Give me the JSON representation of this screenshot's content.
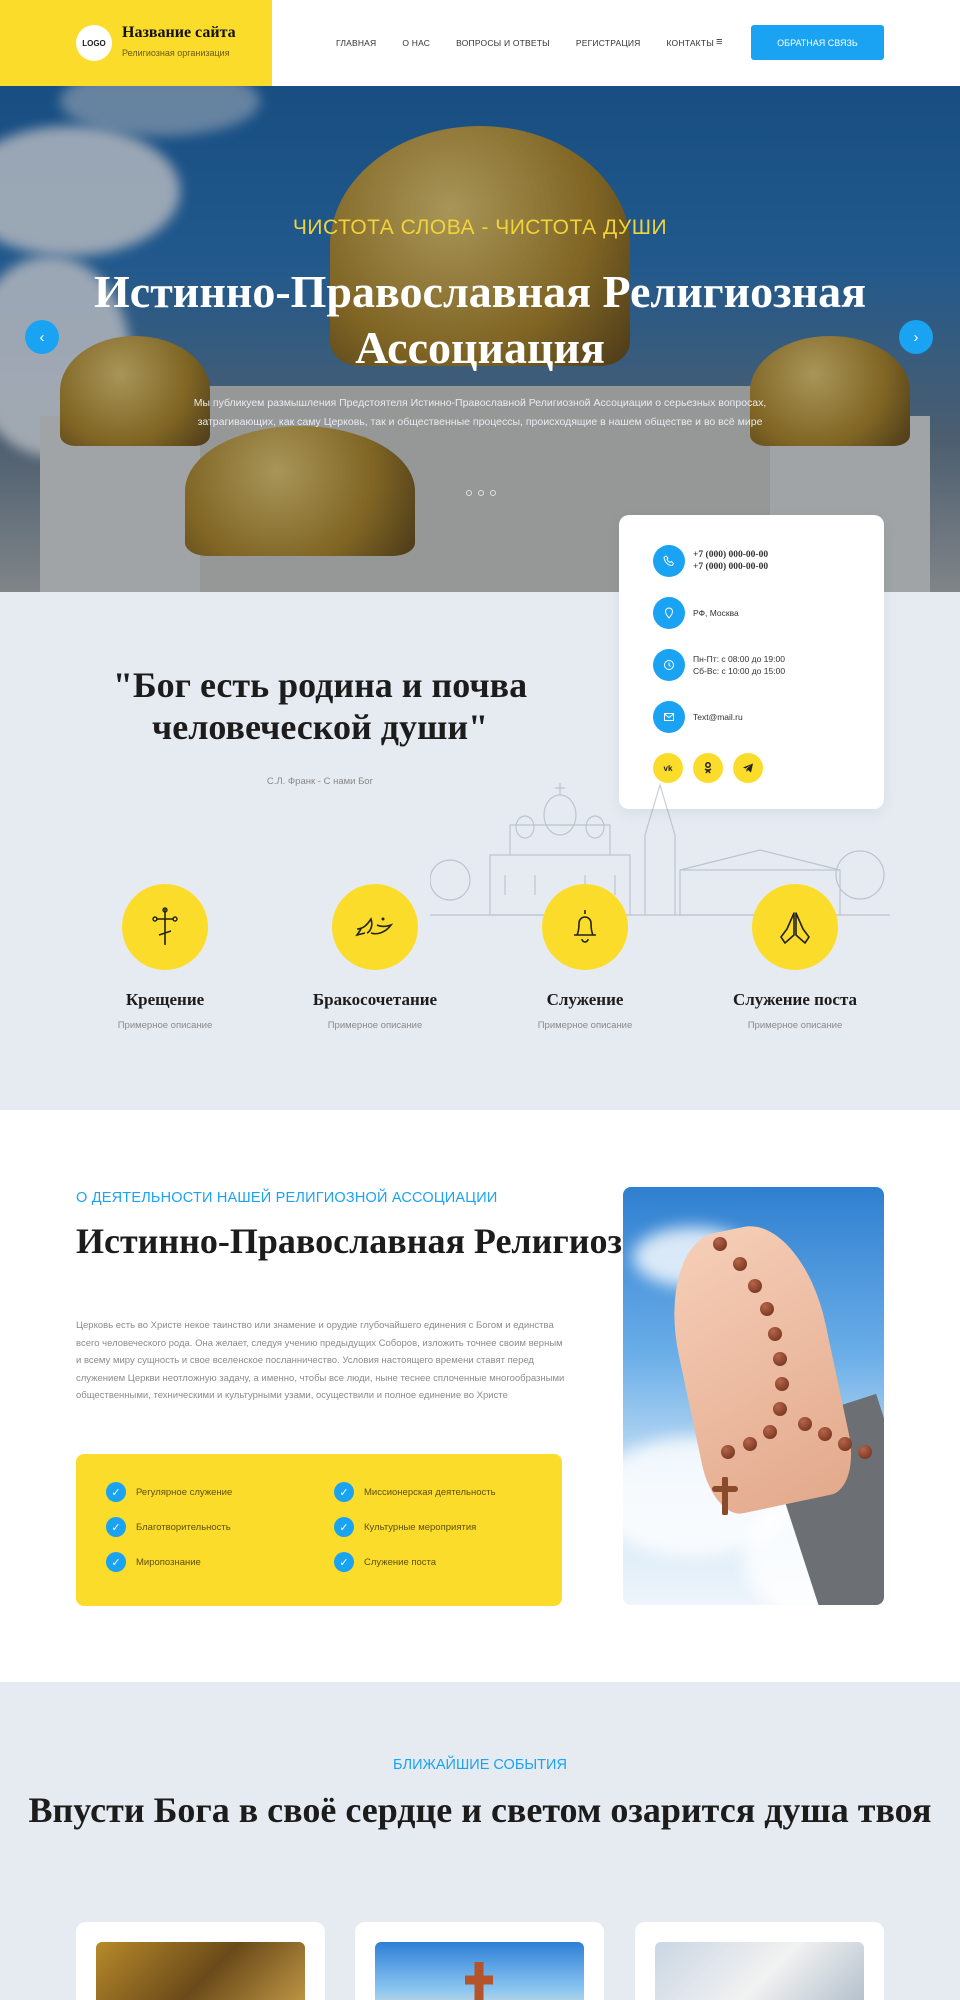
{
  "header": {
    "logo": "LOGO",
    "site_title": "Название сайта",
    "site_subtitle": "Религиозная организация",
    "nav": [
      "ГЛАВНАЯ",
      "О НАС",
      "ВОПРОСЫ И ОТВЕТЫ",
      "РЕГИСТРАЦИЯ",
      "КОНТАКТЫ"
    ],
    "menu_icon": "≡",
    "callback_label": "ОБРАТНАЯ СВЯЗЬ"
  },
  "hero": {
    "kicker": "ЧИСТОТА СЛОВА - ЧИСТОТА ДУШИ",
    "title": "Истинно-Православная Религиозная Ассоциация",
    "description": "Мы публикуем размышления Предстоятеля Истинно-Православной Религиозной Ассоциации о серьезных вопросах, затрагивающих, как саму Церковь, так и общественные процессы, происходящие в нашем обществе и во всё мире",
    "prev_arrow": "‹",
    "next_arrow": "›"
  },
  "contacts": {
    "phone1": "+7 (000) 000-00-00",
    "phone2": "+7 (000) 000-00-00",
    "address": "РФ, Москва",
    "hours1": "Пн-Пт: с 08:00 до 19:00",
    "hours2": "Сб-Вс: с 10:00 до 15:00",
    "email": "Text@mail.ru",
    "socials": [
      "vk",
      "ok",
      "telegram"
    ]
  },
  "quote": {
    "text": "\"Бог есть родина и почва человеческой души\"",
    "source": "С.Л. Франк - С нами Бог"
  },
  "services": [
    {
      "icon": "cross-icon",
      "title": "Крещение",
      "desc": "Примерное описание"
    },
    {
      "icon": "dove-icon",
      "title": "Бракосочетание",
      "desc": "Примерное описание"
    },
    {
      "icon": "bell-icon",
      "title": "Служение",
      "desc": "Примерное описание"
    },
    {
      "icon": "praying-hands-icon",
      "title": "Служение поста",
      "desc": "Примерное описание"
    }
  ],
  "about": {
    "kicker": "О ДЕЯТЕЛЬНОСТИ НАШЕЙ РЕЛИГИОЗНОЙ АССОЦИАЦИИ",
    "title": "Истинно-Православная Религиозная Ассоциация",
    "text": "Церковь есть во Христе некое таинство или знамение и орудие глубочайшего единения с Богом и единства всего человеческого рода. Она желает, следуя учению предыдущих Соборов, изложить точнее своим верным и всему миру сущность и свое вселенское посланничество. Условия настоящего времени ставят перед служением Церкви неотложную задачу, а именно, чтобы все люди, ныне теснее сплоченные многообразными общественными, техническими и культурными узами, осуществили и полное единение во Христе",
    "features": [
      "Регулярное служение",
      "Миссионерская деятельность",
      "Благотворительность",
      "Культурные мероприятия",
      "Миропознание",
      "Служение поста"
    ]
  },
  "events": {
    "kicker": "БЛИЖАЙШИЕ СОБЫТИЯ",
    "title": "Впусти Бога в своё сердце и светом озарится душа твоя"
  },
  "colors": {
    "accent_yellow": "#fcdc2a",
    "accent_blue": "#1aa3f2",
    "background": "#e6ebf2"
  }
}
